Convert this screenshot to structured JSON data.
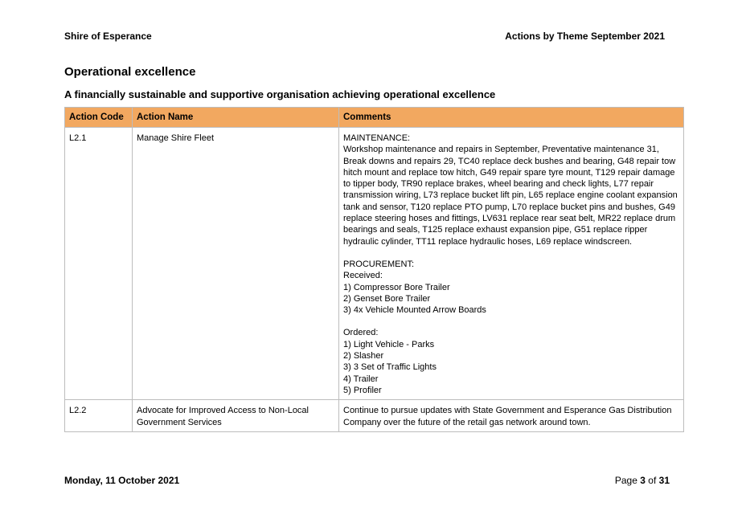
{
  "header": {
    "org": "Shire of Esperance",
    "report": "Actions by Theme September 2021"
  },
  "section_title": "Operational excellence",
  "subtitle": "A financially sustainable and supportive organisation achieving operational excellence",
  "table": {
    "columns": [
      "Action Code",
      "Action Name",
      "Comments"
    ],
    "rows": [
      {
        "code": "L2.1",
        "name": "Manage Shire Fleet",
        "maintenance_heading": "MAINTENANCE:",
        "maintenance_text": "Workshop maintenance and repairs in September, Preventative maintenance 31, Break downs and repairs 29, TC40 replace deck bushes and bearing, G48 repair tow hitch mount and replace tow hitch, G49 repair spare tyre mount, T129 repair damage to tipper body, TR90 replace brakes, wheel bearing and check lights, L77 repair transmission wiring, L73 replace bucket lift pin, L65 replace engine coolant expansion tank and sensor, T120 replace PTO pump, L70 replace bucket pins and bushes, G49 replace steering hoses and fittings, LV631 replace rear seat belt, MR22 replace drum bearings and seals, T125 replace exhaust expansion pipe, G51 replace ripper hydraulic cylinder, TT11 replace hydraulic hoses, L69 replace windscreen.",
        "procurement_heading": "PROCUREMENT:",
        "received_label": "Received:",
        "received": [
          "1) Compressor Bore Trailer",
          "2) Genset Bore Trailer",
          "3) 4x Vehicle Mounted Arrow Boards"
        ],
        "ordered_label": "Ordered:",
        "ordered": [
          "1) Light Vehicle - Parks",
          "2) Slasher",
          "3) 3 Set of Traffic Lights",
          "4) Trailer",
          "5) Profiler"
        ]
      },
      {
        "code": "L2.2",
        "name": "Advocate for Improved Access to Non-Local Government Services",
        "comment": "Continue to pursue updates with State Government and Esperance Gas Distribution Company over the future of the retail gas network around town."
      }
    ]
  },
  "footer": {
    "date": "Monday, 11 October 2021",
    "page_label": "Page",
    "page_current": "3",
    "page_of": "of",
    "page_total": "31"
  }
}
